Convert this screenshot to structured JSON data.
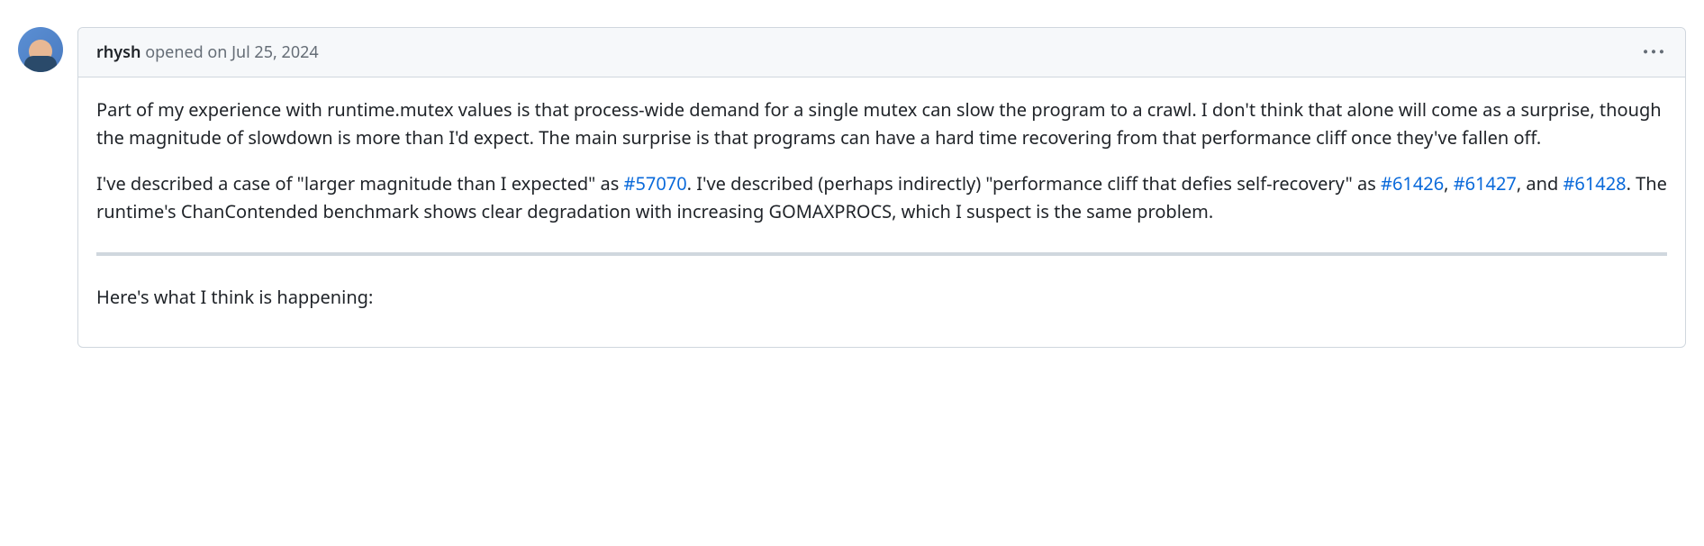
{
  "author": "rhysh",
  "action": "opened on",
  "date": "Jul 25, 2024",
  "links": {
    "link1": "#57070",
    "link2": "#61426",
    "link3": "#61427",
    "link4": "#61428"
  },
  "body": {
    "p1": "Part of my experience with runtime.mutex values is that process-wide demand for a single mutex can slow the program to a crawl. I don't think that alone will come as a surprise, though the magnitude of slowdown is more than I'd expect. The main surprise is that programs can have a hard time recovering from that performance cliff once they've fallen off.",
    "p2_part1": "I've described a case of \"larger magnitude than I expected\" as ",
    "p2_part2": ". I've described (perhaps indirectly) \"performance cliff that defies self-recovery\" as ",
    "p2_part3": ", ",
    "p2_part4": ", and ",
    "p2_part5": ". The runtime's ChanContended benchmark shows clear degradation with increasing GOMAXPROCS, which I suspect is the same problem.",
    "p3": "Here's what I think is happening:"
  }
}
